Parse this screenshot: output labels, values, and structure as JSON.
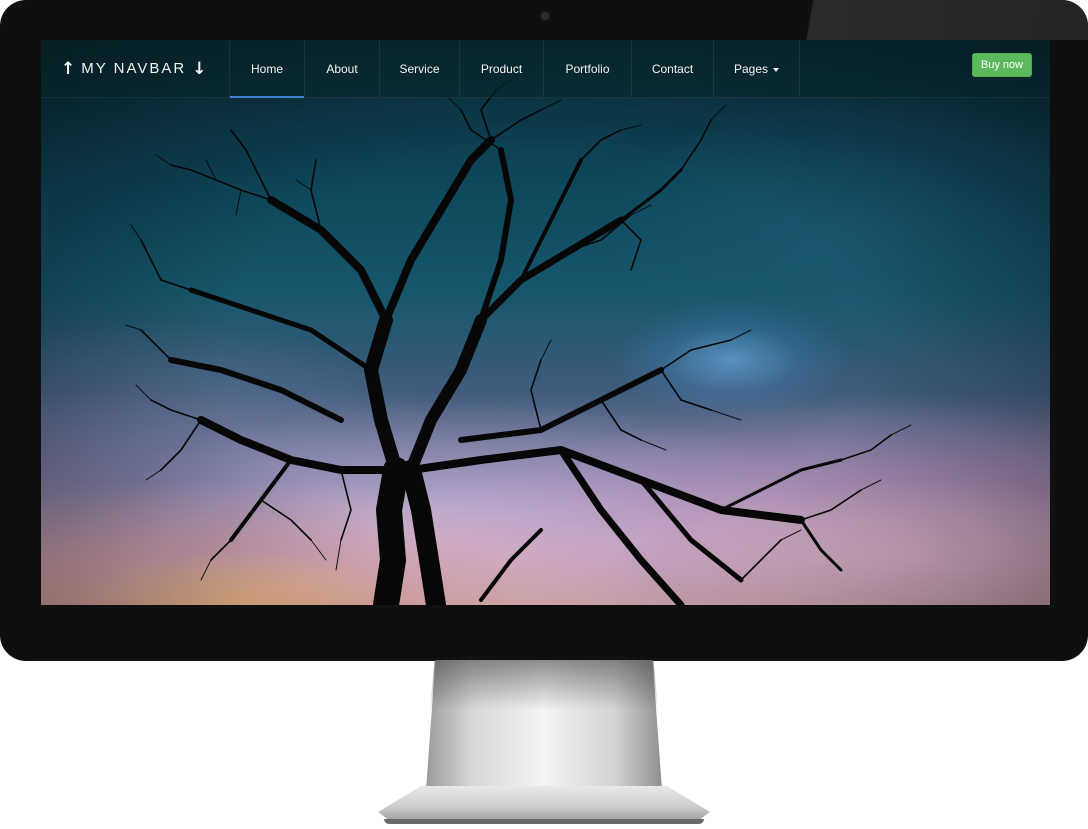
{
  "navbar": {
    "brand": {
      "left_icon": "arrow-up-icon",
      "label": "MY NAVBAR",
      "right_icon": "arrow-down-icon",
      "left_glyph": "↑",
      "right_glyph": "↓"
    },
    "items": [
      {
        "label": "Home",
        "active": true
      },
      {
        "label": "About",
        "active": false
      },
      {
        "label": "Service",
        "active": false
      },
      {
        "label": "Product",
        "active": false
      },
      {
        "label": "Portfolio",
        "active": false
      },
      {
        "label": "Contact",
        "active": false
      },
      {
        "label": "Pages",
        "active": false,
        "dropdown": true
      }
    ],
    "cta": {
      "label": "Buy now",
      "color": "#5cb85c"
    }
  },
  "colors": {
    "active_underline": "#3f7fd0",
    "bezel": "#0f0f0f"
  }
}
